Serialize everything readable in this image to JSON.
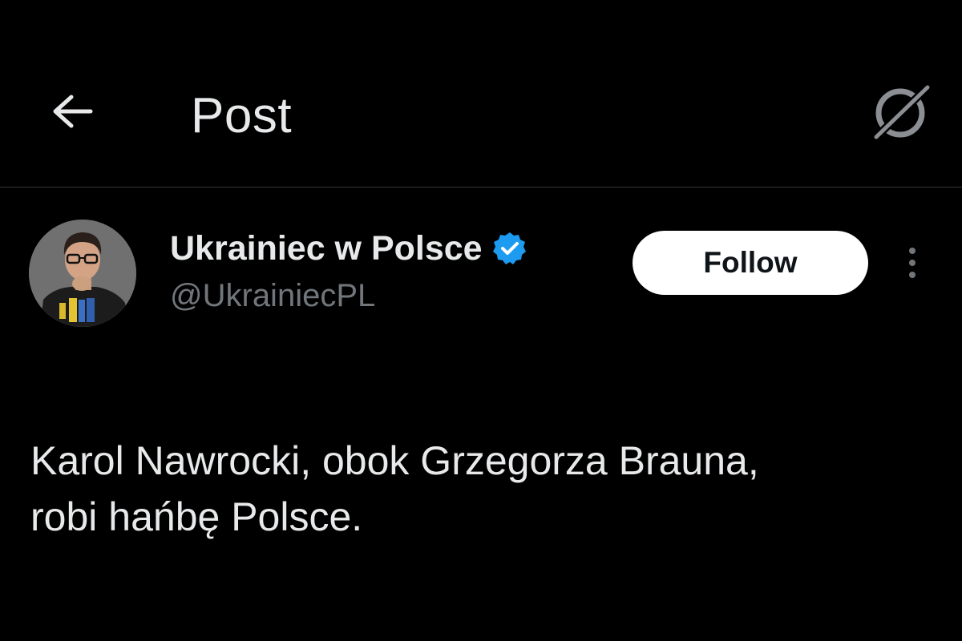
{
  "header": {
    "back_icon": "arrow-left-icon",
    "title": "Post",
    "grok_icon": "grok-icon"
  },
  "post": {
    "author": {
      "name": "Ukrainiec w Polsce",
      "handle": "@UkrainiecPL",
      "verified": true,
      "verified_color": "#1d9bf0",
      "avatar_icon": "avatar"
    },
    "follow_label": "Follow",
    "more_icon": "more-vertical-icon",
    "text_lines": [
      "Karol Nawrocki, obok Grzegorza Brauna,",
      "robi hańbę Polsce."
    ]
  },
  "colors": {
    "background": "#000000",
    "primary_text": "#e7e9ea",
    "secondary_text": "#71767b",
    "divider": "#2f3336",
    "follow_bg": "#ffffff",
    "follow_text": "#0f1419"
  }
}
